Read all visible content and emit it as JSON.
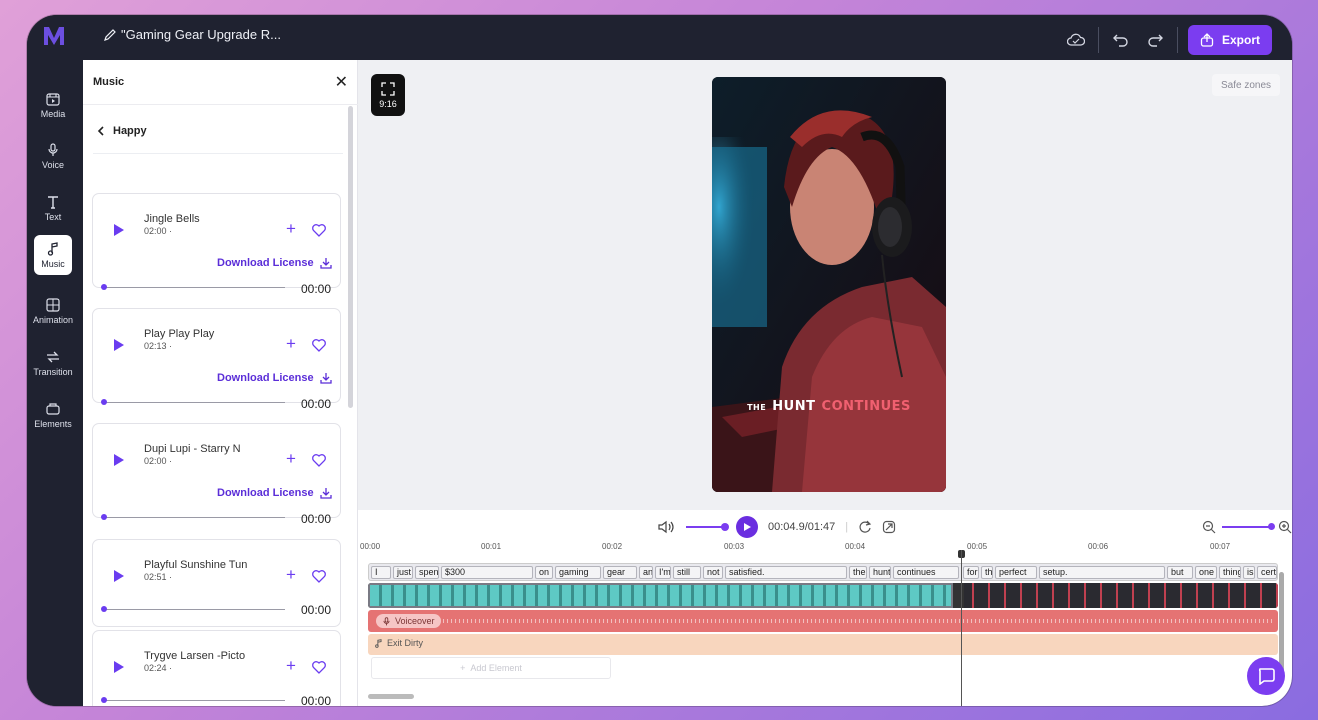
{
  "project": {
    "title": "\"Gaming Gear Upgrade R..."
  },
  "toolbar": {
    "export_label": "Export"
  },
  "sidebar": {
    "items": [
      {
        "label": "Media",
        "icon": "media-icon"
      },
      {
        "label": "Voice",
        "icon": "microphone-icon"
      },
      {
        "label": "Text",
        "icon": "text-icon"
      },
      {
        "label": "Music",
        "icon": "music-note-icon",
        "active": true
      },
      {
        "label": "Animation",
        "icon": "animation-icon"
      },
      {
        "label": "Transition",
        "icon": "transition-icon"
      },
      {
        "label": "Elements",
        "icon": "elements-icon"
      }
    ]
  },
  "music_panel": {
    "title": "Music",
    "category": "Happy",
    "download_label": "Download License",
    "tracks": [
      {
        "name": "Jingle Bells",
        "duration": "02:00 ·",
        "time": "00:00"
      },
      {
        "name": "Play Play Play",
        "duration": "02:13 ·",
        "time": "00:00"
      },
      {
        "name": "Dupi Lupi - Starry N",
        "duration": "02:00 ·",
        "time": "00:00"
      },
      {
        "name": "Playful Sunshine Tun",
        "duration": "02:51 ·",
        "time": "00:00"
      },
      {
        "name": "Trygve Larsen -Picto",
        "duration": "02:24 ·",
        "time": "00:00"
      }
    ]
  },
  "canvas": {
    "aspect_ratio": "9:16",
    "safe_zones_label": "Safe zones",
    "caption": {
      "small": "THE",
      "white": "HUNT",
      "red": "CONTINUES"
    }
  },
  "player": {
    "time": "00:04.9/01:47"
  },
  "timeline": {
    "ruler": [
      "00:00",
      "00:01",
      "00:02",
      "00:03",
      "00:04",
      "00:05",
      "00:06",
      "00:07"
    ],
    "words": [
      "I",
      "just",
      "spent",
      "$300",
      "on",
      "gaming",
      "gear",
      "and",
      "I'm",
      "still",
      "not",
      "satisfied.",
      "the",
      "hunt",
      "continues",
      "for",
      "the",
      "perfect",
      "setup.",
      "but",
      "one",
      "thing",
      "is",
      "cert"
    ],
    "voiceover_label": "Voiceover",
    "music_label": "Exit Dirty",
    "add_element_label": "Add Element"
  },
  "colors": {
    "accent": "#7b3df0",
    "frame": "#1f2230",
    "voiceover": "#e57373",
    "music_track": "#f8d6be"
  }
}
